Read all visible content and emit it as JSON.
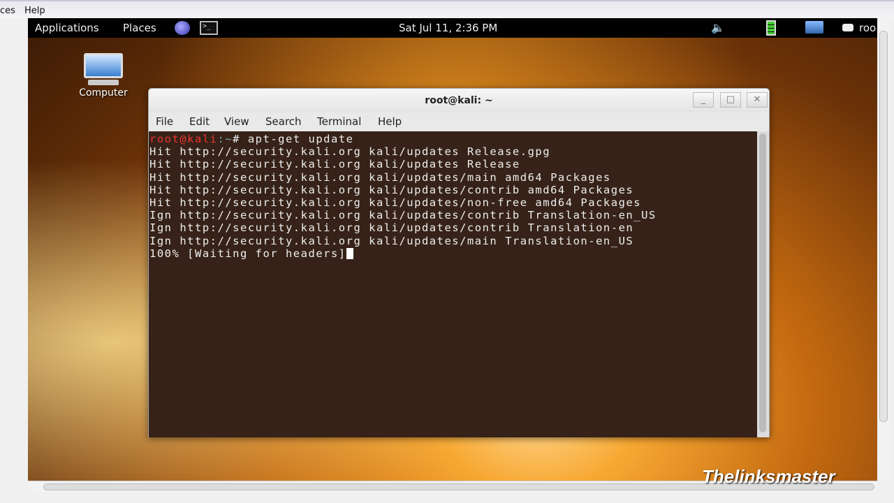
{
  "host_menu": {
    "items": [
      "ces",
      "Help"
    ]
  },
  "panel": {
    "applications": "Applications",
    "places": "Places",
    "clock": "Sat Jul 11,  2:36 PM",
    "user": "roo"
  },
  "desktop": {
    "computer_label": "Computer"
  },
  "window": {
    "title": "root@kali: ~",
    "menu": [
      "File",
      "Edit",
      "View",
      "Search",
      "Terminal",
      "Help"
    ]
  },
  "terminal": {
    "prompt_user": "root@kali",
    "prompt_path": ":~",
    "prompt_symbol": "# ",
    "command": "apt-get update",
    "lines": [
      "Hit http://security.kali.org kali/updates Release.gpg",
      "Hit http://security.kali.org kali/updates Release",
      "Hit http://security.kali.org kali/updates/main amd64 Packages",
      "Hit http://security.kali.org kali/updates/contrib amd64 Packages",
      "Hit http://security.kali.org kali/updates/non-free amd64 Packages",
      "Ign http://security.kali.org kali/updates/contrib Translation-en_US",
      "Ign http://security.kali.org kali/updates/contrib Translation-en",
      "Ign http://security.kali.org kali/updates/main Translation-en_US"
    ],
    "status": "100% [Waiting for headers]"
  },
  "watermark": "Thelinksmaster"
}
